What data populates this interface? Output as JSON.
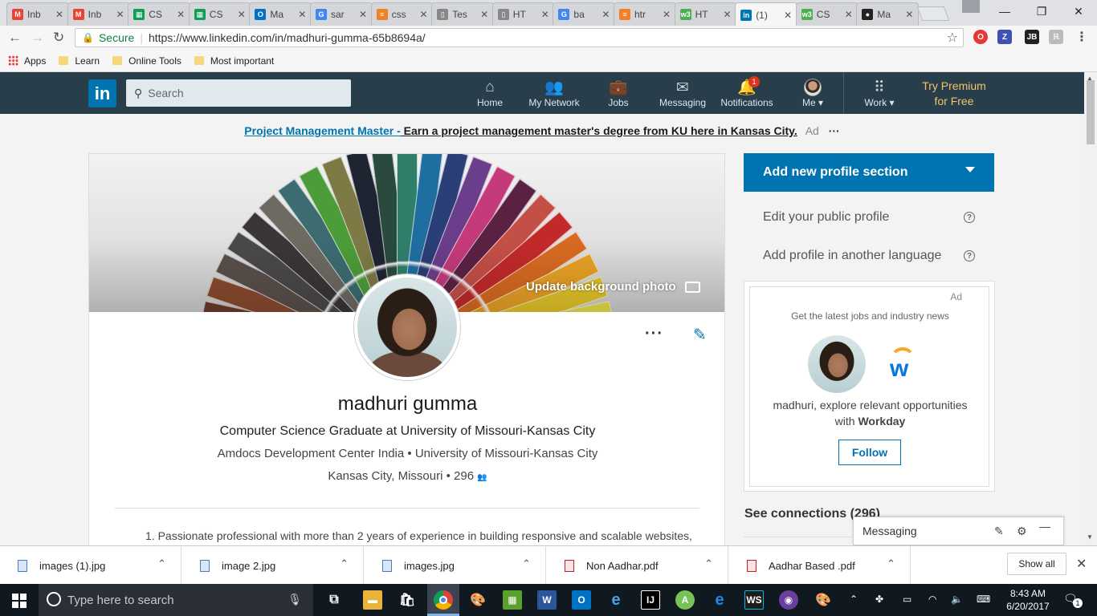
{
  "browser": {
    "tabs": [
      {
        "title": "Inb",
        "favicon_color": "#ea4335",
        "favicon": "gmail-icon",
        "glyph": "M"
      },
      {
        "title": "Inb",
        "favicon_color": "#ea4335",
        "favicon": "gmail-icon",
        "glyph": "M"
      },
      {
        "title": "CS",
        "favicon_color": "#0f9d58",
        "favicon": "sheets-icon",
        "glyph": "▦"
      },
      {
        "title": "CS",
        "favicon_color": "#0f9d58",
        "favicon": "sheets-icon",
        "glyph": "▦"
      },
      {
        "title": "Ma",
        "favicon_color": "#0072c6",
        "favicon": "outlook-icon",
        "glyph": "O"
      },
      {
        "title": "sar",
        "favicon_color": "#4285f4",
        "favicon": "google-icon",
        "glyph": "G"
      },
      {
        "title": "css",
        "favicon_color": "#f48024",
        "favicon": "stackoverflow-icon",
        "glyph": "≡"
      },
      {
        "title": "Tes",
        "favicon_color": "#888888",
        "favicon": "document-icon",
        "glyph": "▯"
      },
      {
        "title": "HT",
        "favicon_color": "#888888",
        "favicon": "document-icon",
        "glyph": "▯"
      },
      {
        "title": "ba",
        "favicon_color": "#4285f4",
        "favicon": "google-icon",
        "glyph": "G"
      },
      {
        "title": "htr",
        "favicon_color": "#f48024",
        "favicon": "stackoverflow-icon",
        "glyph": "≡"
      },
      {
        "title": "HT",
        "favicon_color": "#4caf50",
        "favicon": "w3schools-icon",
        "glyph": "w3"
      },
      {
        "title": "(1)",
        "favicon_color": "#0077b5",
        "favicon": "linkedin-icon",
        "glyph": "in",
        "active": true
      },
      {
        "title": "CS",
        "favicon_color": "#4caf50",
        "favicon": "w3schools-icon",
        "glyph": "w3"
      },
      {
        "title": "Ma",
        "favicon_color": "#222222",
        "favicon": "github-icon",
        "glyph": "●"
      }
    ],
    "secure_label": "Secure",
    "url": "https://www.linkedin.com/in/madhuri-gumma-65b8694a/",
    "bookmarks": {
      "apps": "Apps",
      "learn": "Learn",
      "online_tools": "Online Tools",
      "most_important": "Most important"
    }
  },
  "linkedin": {
    "search_placeholder": "Search",
    "nav": {
      "home": "Home",
      "network": "My Network",
      "jobs": "Jobs",
      "messaging": "Messaging",
      "notifications": "Notifications",
      "notifications_count": "1",
      "me": "Me ▾",
      "work": "Work ▾",
      "premium_line1": "Try Premium",
      "premium_line2": "for Free"
    },
    "ad_line": {
      "link": "Project Management Master -",
      "text": " Earn a project management master's degree from KU here in Kansas City.",
      "ad": "Ad",
      "more": "···"
    },
    "profile": {
      "update_bg": "Update background photo",
      "name": "madhuri gumma",
      "headline": "Computer Science Graduate at University of Missouri-Kansas City",
      "company": "Amdocs Development Center India",
      "school": "University of Missouri-Kansas City",
      "location": "Kansas City, Missouri",
      "connections": "296",
      "summary": "1. Passionate professional with more than 2 years of experience in building responsive and scalable websites,"
    },
    "rail": {
      "add_section": "Add new profile section",
      "edit_public": "Edit your public profile",
      "add_language": "Add profile in another language",
      "ad_label": "Ad",
      "ad_tagline": "Get the latest jobs and industry news",
      "ad_msg_prefix": "madhuri, explore relevant opportunities",
      "ad_msg_with": "with ",
      "ad_msg_company": "Workday",
      "follow": "Follow",
      "see_connections": "See connections (296)"
    },
    "messaging_bar": "Messaging"
  },
  "downloads": [
    {
      "name": "images (1).jpg",
      "kind": "image"
    },
    {
      "name": "image 2.jpg",
      "kind": "image"
    },
    {
      "name": "images.jpg",
      "kind": "image"
    },
    {
      "name": "Non Aadhar.pdf",
      "kind": "pdf"
    },
    {
      "name": "Aadhar Based .pdf",
      "kind": "pdf"
    }
  ],
  "downloads_show_all": "Show all",
  "taskbar": {
    "search_placeholder": "Type here to search",
    "time": "8:43 AM",
    "date": "6/20/2017",
    "notif_count": "1"
  },
  "colors": {
    "linkedin_blue": "#0073b1",
    "header_bg": "#283e4a",
    "premium_gold": "#f5c26b"
  },
  "swatch_colors": [
    "#6b3a2a",
    "#8a4a2e",
    "#5a4f4a",
    "#4a4848",
    "#3a3538",
    "#6d6a62",
    "#3c6b72",
    "#4d9c3a",
    "#7d7a45",
    "#1e2432",
    "#2a4a3e",
    "#2f7f6a",
    "#1f6ea0",
    "#2a3f78",
    "#6a3e8a",
    "#c43a7a",
    "#5b2143",
    "#c44f47",
    "#c22a2a",
    "#d86a22",
    "#e8a126",
    "#e4c52a",
    "#eadf4a"
  ]
}
